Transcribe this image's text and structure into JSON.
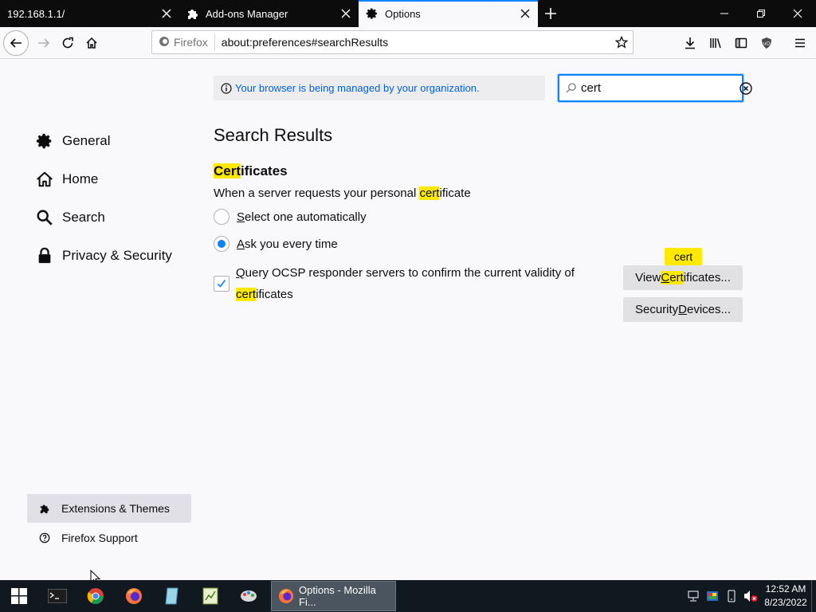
{
  "tabs": [
    {
      "title": "192.168.1.1/",
      "icon": "none"
    },
    {
      "title": "Add-ons Manager",
      "icon": "puzzle-icon"
    },
    {
      "title": "Options",
      "icon": "gear-icon",
      "selected": true
    }
  ],
  "toolbar": {
    "identity_label": "Firefox",
    "url": "about:preferences#searchResults"
  },
  "banner": {
    "text": "Your browser is being managed by your organization."
  },
  "search": {
    "value": "cert"
  },
  "sidebar": {
    "categories": [
      {
        "label": "General",
        "icon": "gear-icon"
      },
      {
        "label": "Home",
        "icon": "home-icon"
      },
      {
        "label": "Search",
        "icon": "search-icon"
      },
      {
        "label": "Privacy & Security",
        "icon": "lock-icon"
      }
    ],
    "footer": [
      {
        "label": "Extensions & Themes",
        "icon": "puzzle-icon"
      },
      {
        "label": "Firefox Support",
        "icon": "help-icon"
      }
    ]
  },
  "main": {
    "title": "Search Results",
    "section": {
      "hl": "Cert",
      "rest": "ificates"
    },
    "description": {
      "pre": "When a server requests your personal ",
      "hl": "cert",
      "post": "ificate"
    },
    "radio1": {
      "ul": "S",
      "rest": "elect one automatically",
      "checked": false
    },
    "radio2": {
      "ul": "A",
      "rest": "sk you every time",
      "checked": true
    },
    "ocsp": {
      "ul": "Q",
      "rest": "uery OCSP responder servers to confirm the current validity of ",
      "hl": "cert",
      "tail": "ificates",
      "checked": true
    },
    "view_certs": {
      "pre": "View ",
      "hl_ul": "C",
      "hl_rest": "ert",
      "post": "ificates..."
    },
    "sec_devices": {
      "pre": "Security ",
      "ul": "D",
      "post": "evices..."
    },
    "badge": "cert"
  },
  "taskbar": {
    "active_window": "Options - Mozilla Fi...",
    "time": "12:52 AM",
    "date": "8/23/2022"
  },
  "colors": {
    "accent": "#0a84ff",
    "highlight": "#ffe900",
    "link": "#0060df"
  }
}
